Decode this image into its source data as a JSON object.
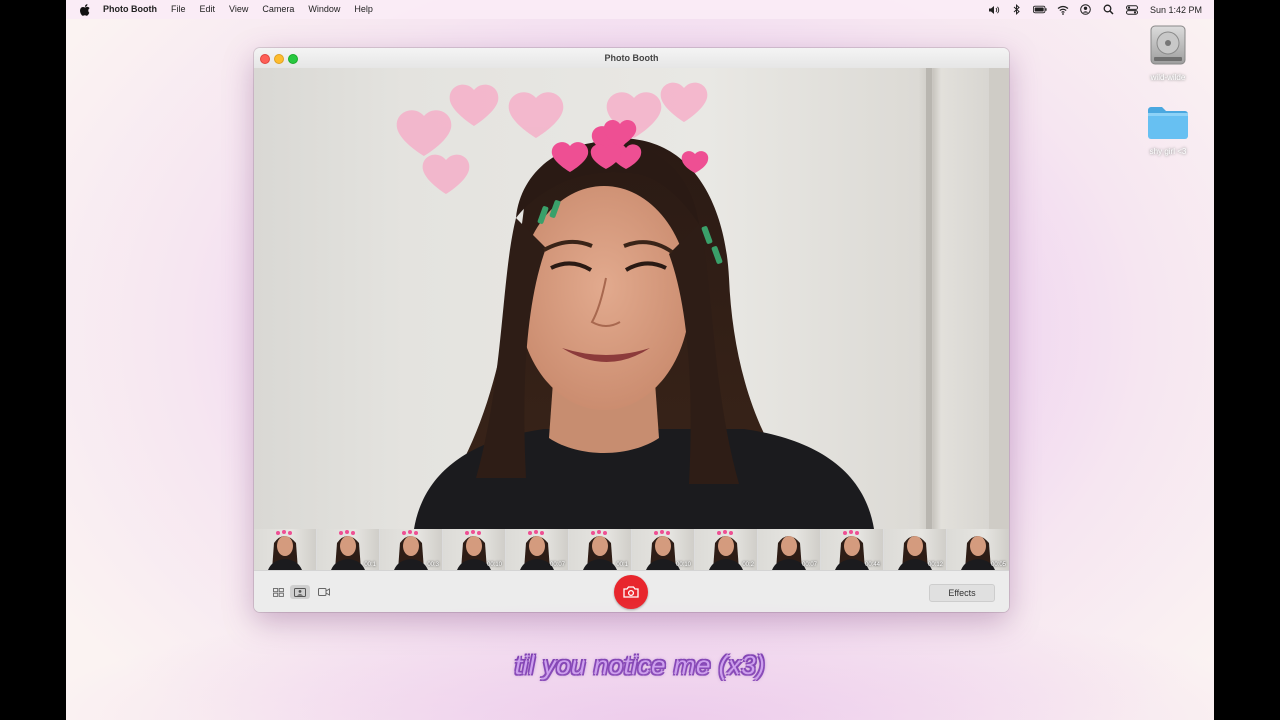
{
  "menubar": {
    "app_name": "Photo Booth",
    "items": [
      "File",
      "Edit",
      "View",
      "Camera",
      "Window",
      "Help"
    ],
    "clock": "Sun 1:42 PM"
  },
  "desktop": {
    "icons": [
      {
        "label": "wild-wilde",
        "icon": "hard-drive-icon"
      },
      {
        "label": "shy girl <3",
        "icon": "folder-icon"
      }
    ]
  },
  "window": {
    "title": "Photo Booth",
    "effects_label": "Effects",
    "thumbnails": [
      {
        "time": ""
      },
      {
        "time": "00:1"
      },
      {
        "time": "00:3"
      },
      {
        "time": "00:10"
      },
      {
        "time": "00:07"
      },
      {
        "time": "00:1"
      },
      {
        "time": "00:10"
      },
      {
        "time": "00:2"
      },
      {
        "time": "00:07"
      },
      {
        "time": "00:44"
      },
      {
        "time": "00:12"
      },
      {
        "time": "00:05"
      }
    ]
  },
  "caption": "til you notice me (x3)",
  "colors": {
    "shutter": "#e8262d",
    "caption_fill": "#c79cf0",
    "caption_outline": "#6a2aa8",
    "hearts": "#f06da2"
  }
}
